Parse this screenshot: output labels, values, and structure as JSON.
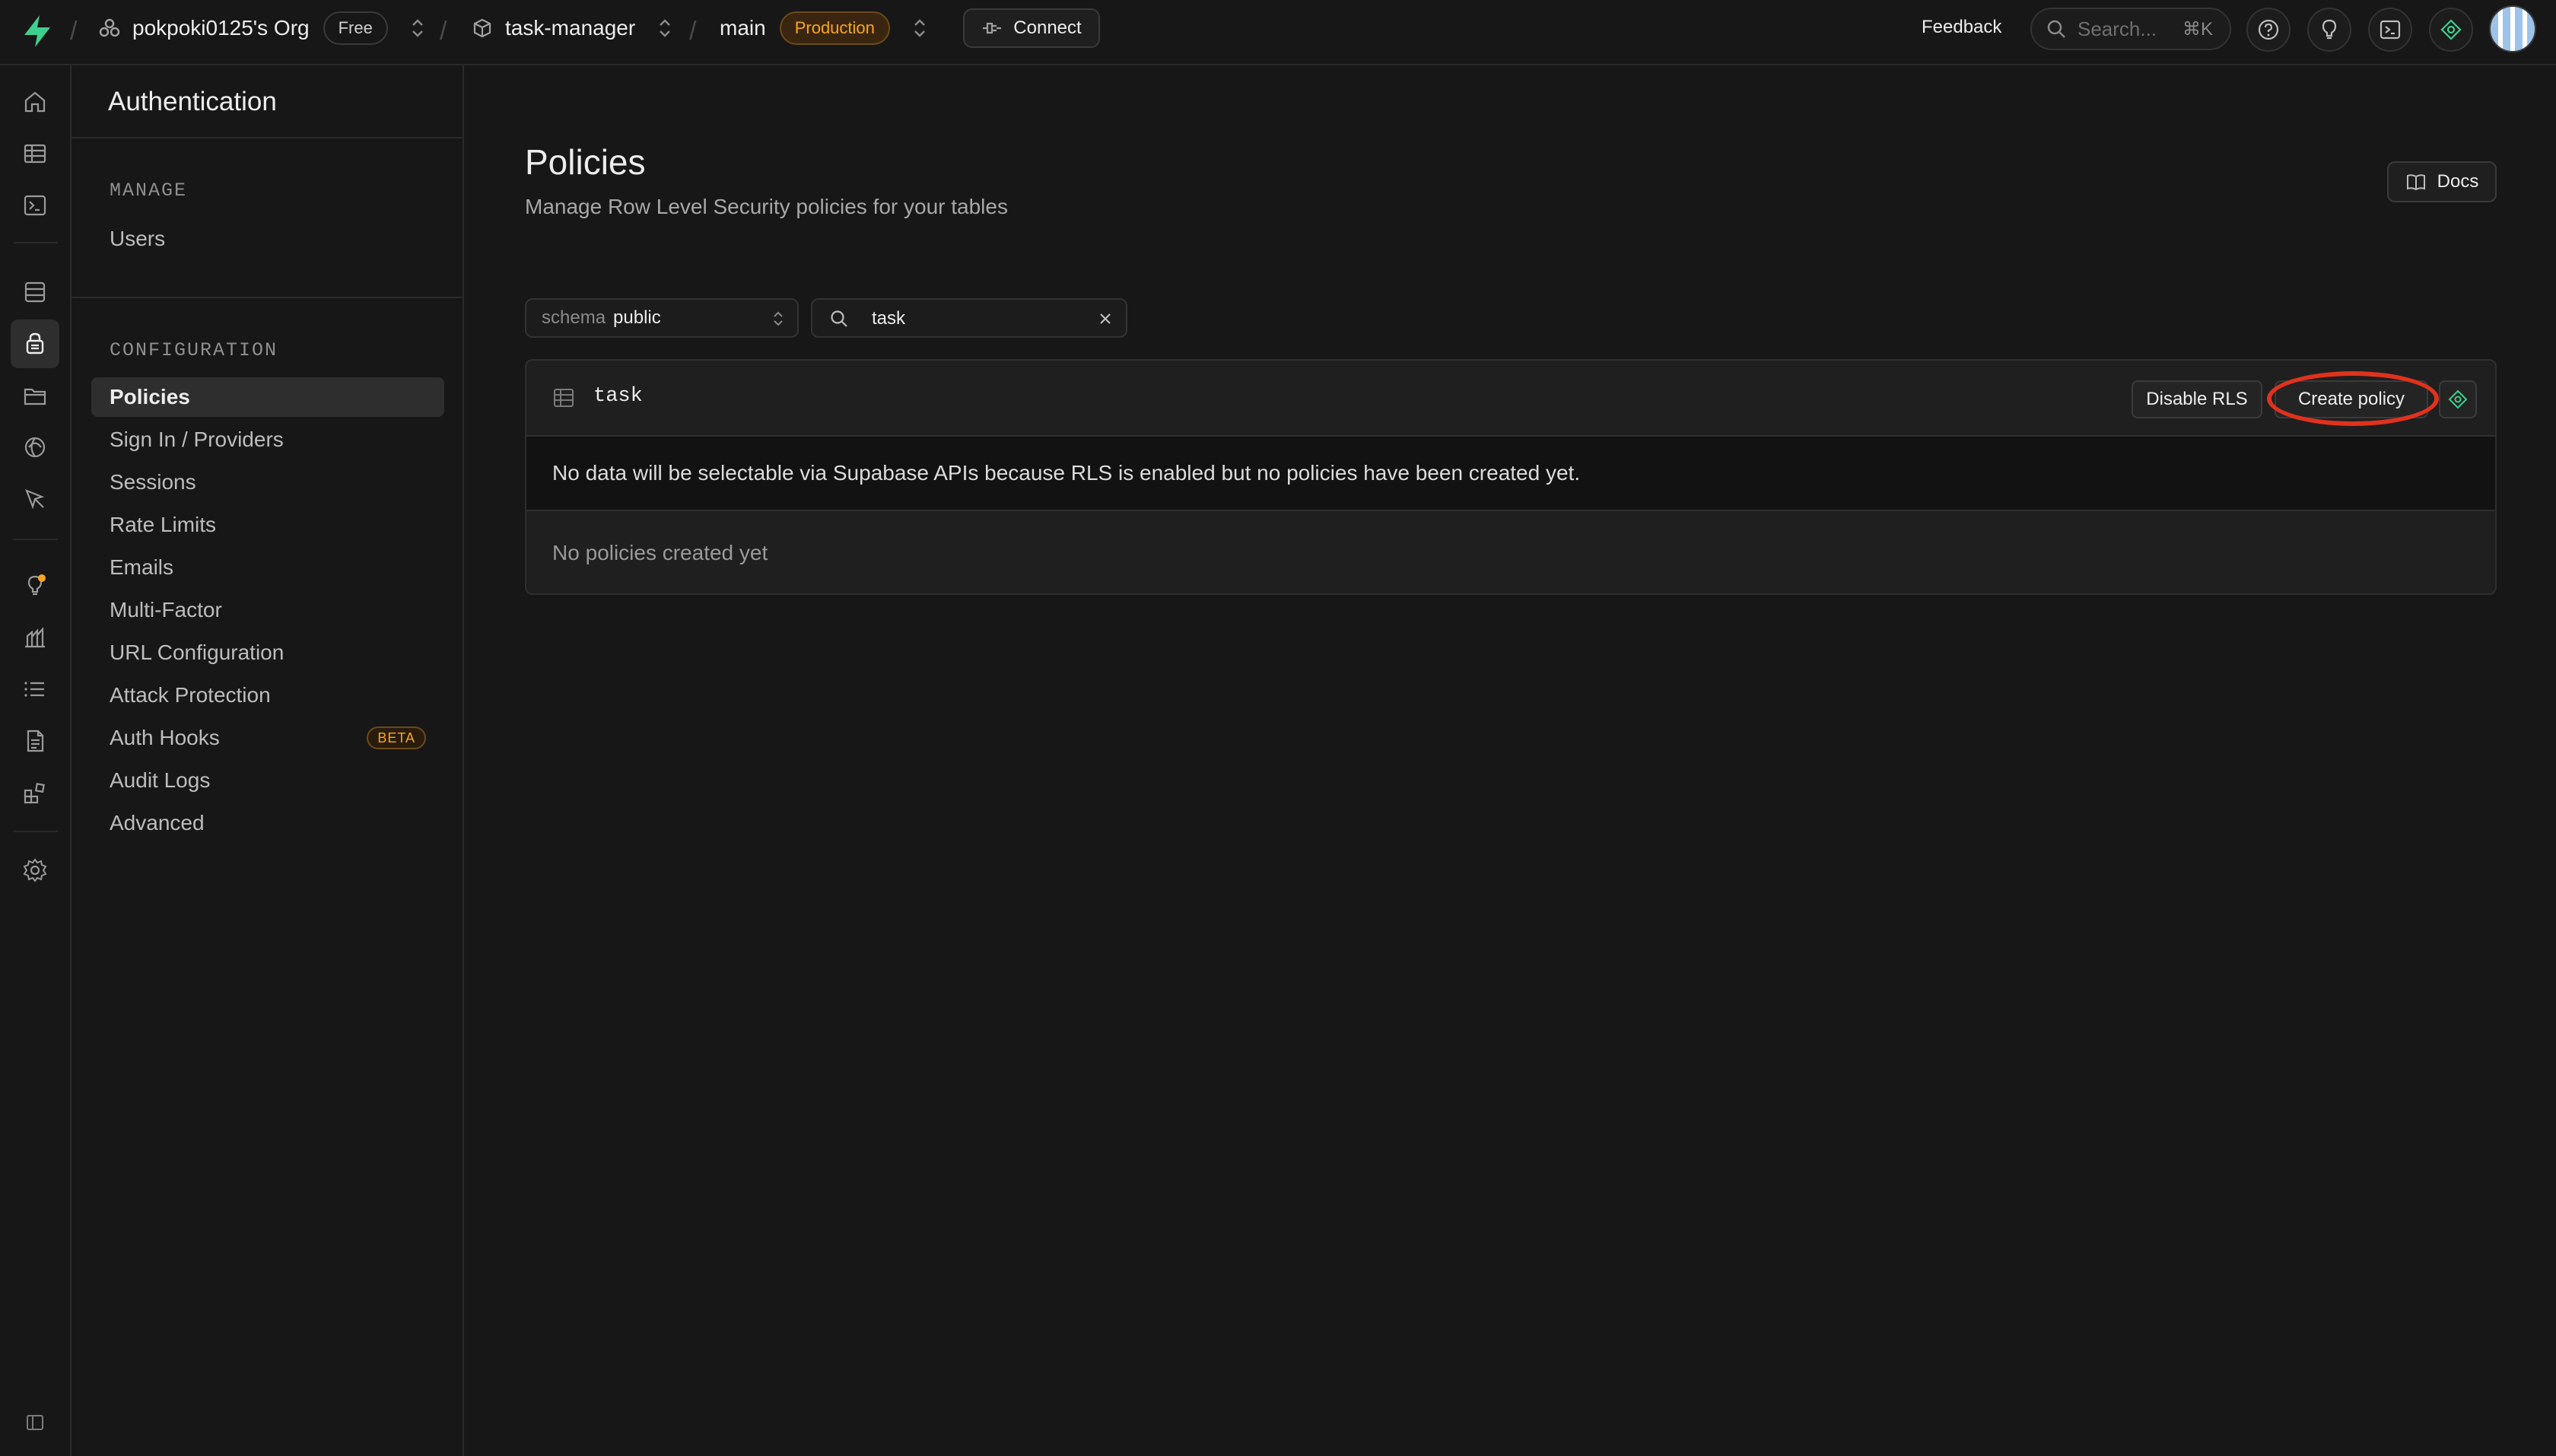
{
  "topbar": {
    "org_name": "pokpoki0125's Org",
    "plan_badge": "Free",
    "project_name": "task-manager",
    "branch_name": "main",
    "env_badge": "Production",
    "connect_label": "Connect",
    "feedback_label": "Feedback",
    "search_placeholder": "Search...",
    "search_shortcut": "⌘K",
    "icons": [
      "help-icon",
      "lightbulb-icon",
      "terminal-icon",
      "assistant-icon"
    ]
  },
  "rail": {
    "items": [
      "home",
      "table-editor",
      "sql-editor",
      "database",
      "authentication",
      "storage",
      "realtime",
      "edge-functions",
      "advisors",
      "reports",
      "logs",
      "api-docs",
      "integrations",
      "settings"
    ],
    "active": "authentication"
  },
  "sidebar": {
    "title": "Authentication",
    "manage_label": "MANAGE",
    "manage_items": [
      {
        "label": "Users"
      }
    ],
    "config_label": "CONFIGURATION",
    "config_items": [
      {
        "label": "Policies"
      },
      {
        "label": "Sign In / Providers"
      },
      {
        "label": "Sessions"
      },
      {
        "label": "Rate Limits"
      },
      {
        "label": "Emails"
      },
      {
        "label": "Multi-Factor"
      },
      {
        "label": "URL Configuration"
      },
      {
        "label": "Attack Protection"
      },
      {
        "label": "Auth Hooks",
        "badge": "BETA"
      },
      {
        "label": "Audit Logs"
      },
      {
        "label": "Advanced"
      }
    ],
    "active_item": "Policies"
  },
  "main": {
    "title": "Policies",
    "subtitle": "Manage Row Level Security policies for your tables",
    "docs_label": "Docs",
    "schema_label": "schema",
    "schema_value": "public",
    "filter_value": "task",
    "table": {
      "name": "task",
      "disable_rls_label": "Disable RLS",
      "create_policy_label": "Create policy",
      "warning": "No data will be selectable via Supabase APIs because RLS is enabled but no policies have been created yet.",
      "empty": "No policies created yet"
    }
  },
  "colors": {
    "background": "#171717",
    "accent_green": "#3ecf8e",
    "badge_orange": "#f5a623",
    "highlight_red": "#e0321d"
  }
}
